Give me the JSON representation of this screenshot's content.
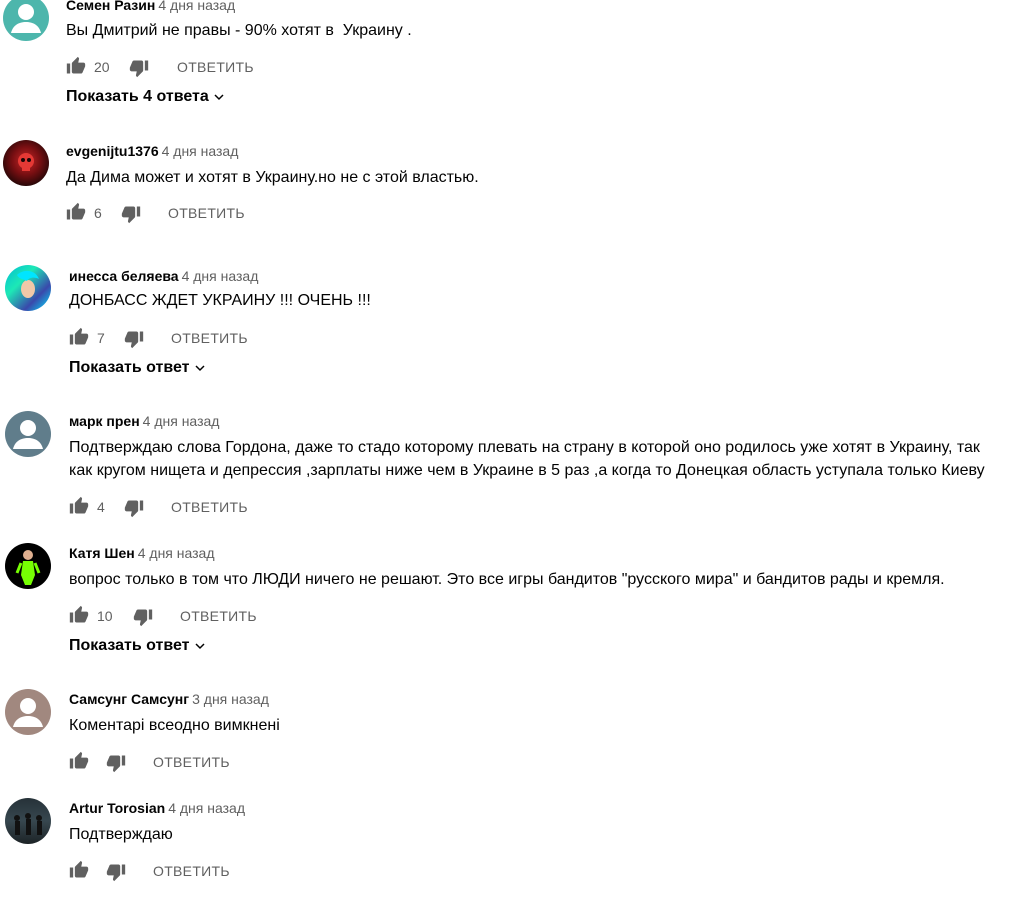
{
  "reply_label": "ОТВЕТИТЬ",
  "colors": {
    "text": "#030303",
    "secondary": "#606060",
    "icon": "#606060"
  },
  "comments": [
    {
      "author": "Семен Разин",
      "time": "4 дня назад",
      "text": "Вы Дмитрий не правы - 90% хотят в  Украину .",
      "likes": "20",
      "show_replies": "Показать 4 ответа",
      "avatar": "default-teal"
    },
    {
      "author": "evgenijtu1376",
      "time": "4 дня назад",
      "text": "Да Дима может и хотят в Украину.но не с этой властью.",
      "likes": "6",
      "show_replies": "",
      "avatar": "red-skull"
    },
    {
      "author": "инесса беляева",
      "time": "4 дня назад",
      "text": "ДОНБАСС ЖДЕТ УКРАИНУ !!! ОЧЕНЬ !!!",
      "likes": "7",
      "show_replies": "Показать ответ",
      "avatar": "blue-hair"
    },
    {
      "author": "марк прен",
      "time": "4 дня назад",
      "text": "Подтверждаю слова Гордона, даже то стадо которому плевать на страну в которой оно родилось уже хотят в Украину, так",
      "text2": "как кругом нищета и депрессия ,зарплаты ниже чем в Украине в 5 раз ,а когда то Донецкая область уступала только Киеву",
      "likes": "4",
      "show_replies": "",
      "avatar": "default-slate"
    },
    {
      "author": "Катя Шен",
      "time": "4 дня назад",
      "text": "вопрос только в том что ЛЮДИ ничего не решают. Это все игры бандитов \"русского мира\" и бандитов рады и кремля.",
      "likes": "10",
      "show_replies": "Показать ответ",
      "avatar": "neon-figure"
    },
    {
      "author": "Самсунг Самсунг",
      "time": "3 дня назад",
      "text": "Коментарі всеодно вимкнені",
      "likes": "",
      "show_replies": "",
      "avatar": "default-mauve"
    },
    {
      "author": "Artur Torosian",
      "time": "4 дня назад",
      "text": "Подтверждаю",
      "likes": "",
      "show_replies": "",
      "avatar": "group-photo"
    }
  ]
}
